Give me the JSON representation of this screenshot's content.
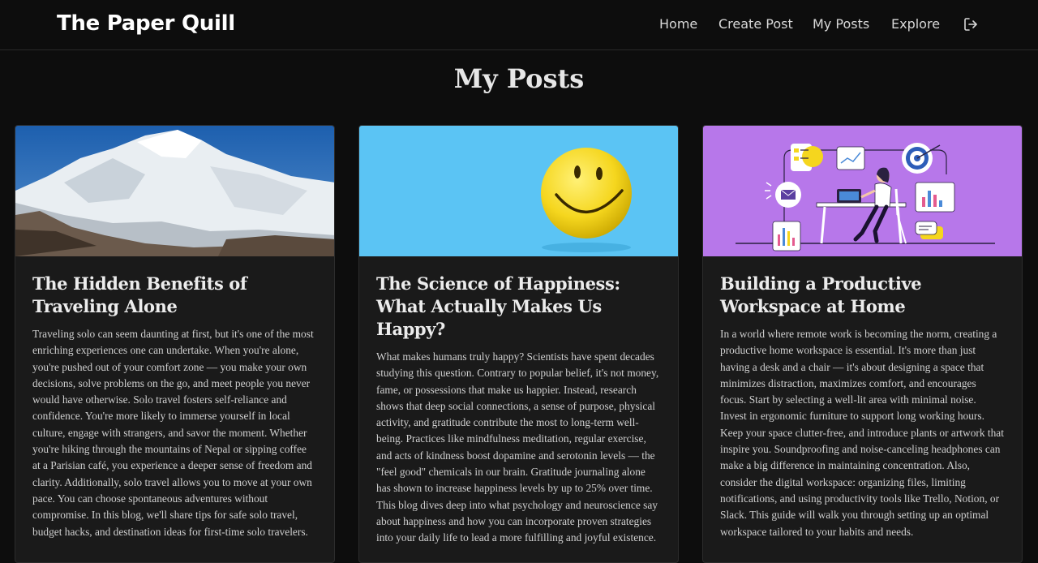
{
  "brand": {
    "name": "The Paper Quill"
  },
  "nav": {
    "links": [
      "Home",
      "Create Post",
      "My Posts",
      "Explore"
    ],
    "logout_icon": "logout-icon"
  },
  "page": {
    "title": "My Posts"
  },
  "posts": [
    {
      "image": "snowy-mountain-image",
      "title": "The Hidden Benefits of Traveling Alone",
      "excerpt": "Traveling solo can seem daunting at first, but it's one of the most enriching experiences one can undertake. When you're alone, you're pushed out of your comfort zone — you make your own decisions, solve problems on the go, and meet people you never would have otherwise. Solo travel fosters self-reliance and confidence. You're more likely to immerse yourself in local culture, engage with strangers, and savor the moment. Whether you're hiking through the mountains of Nepal or sipping coffee at a Parisian café, you experience a deeper sense of freedom and clarity. Additionally, solo travel allows you to move at your own pace. You can choose spontaneous adventures without compromise. In this blog, we'll share tips for safe solo travel, budget hacks, and destination ideas for first-time solo travelers."
    },
    {
      "image": "smiley-face-image",
      "title": "The Science of Happiness: What Actually Makes Us Happy?",
      "excerpt": "What makes humans truly happy? Scientists have spent decades studying this question. Contrary to popular belief, it's not money, fame, or possessions that make us happier. Instead, research shows that deep social connections, a sense of purpose, physical activity, and gratitude contribute the most to long-term well-being. Practices like mindfulness meditation, regular exercise, and acts of kindness boost dopamine and serotonin levels — the \"feel good\" chemicals in our brain. Gratitude journaling alone has shown to increase happiness levels by up to 25% over time. This blog dives deep into what psychology and neuroscience say about happiness and how you can incorporate proven strategies into your daily life to lead a more fulfilling and joyful existence."
    },
    {
      "image": "workspace-illustration-image",
      "title": "Building a Productive Workspace at Home",
      "excerpt": "In a world where remote work is becoming the norm, creating a productive home workspace is essential. It's more than just having a desk and a chair — it's about designing a space that minimizes distraction, maximizes comfort, and encourages focus. Start by selecting a well-lit area with minimal noise. Invest in ergonomic furniture to support long working hours. Keep your space clutter-free, and introduce plants or artwork that inspire you. Soundproofing and noise-canceling headphones can make a big difference in maintaining concentration. Also, consider the digital workspace: organizing files, limiting notifications, and using productivity tools like Trello, Notion, or Slack. This guide will walk you through setting up an optimal workspace tailored to your habits and needs."
    }
  ],
  "colors": {
    "background": "#0d0d0d",
    "card": "#1a1a1a",
    "card_border": "#2c2c2c",
    "sky_blue": "#5bc4f4",
    "smiley_yellow": "#f5d61e",
    "illustration_purple": "#b777ea"
  }
}
